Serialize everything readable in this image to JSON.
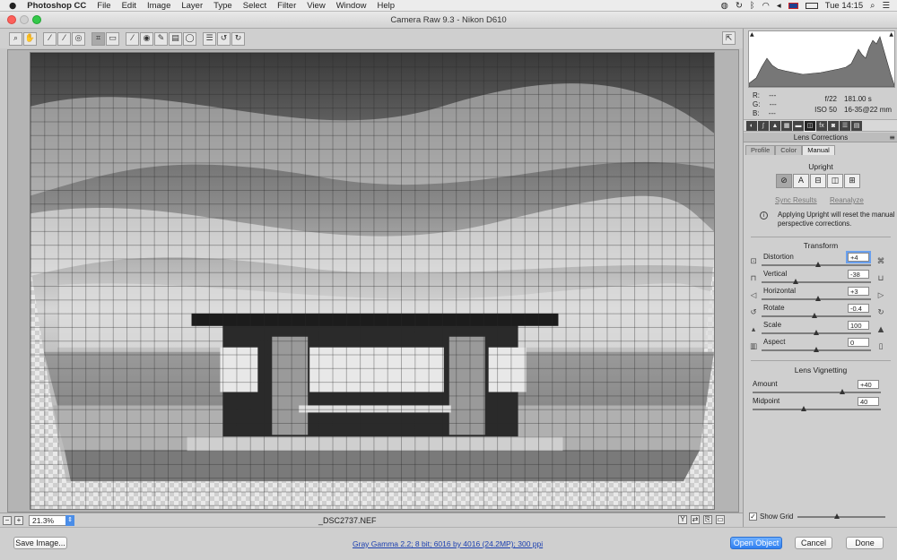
{
  "menubar": {
    "app": "Photoshop CC",
    "items": [
      "File",
      "Edit",
      "Image",
      "Layer",
      "Type",
      "Select",
      "Filter",
      "View",
      "Window",
      "Help"
    ],
    "clock": "Tue 14:15"
  },
  "window": {
    "title": "Camera Raw 9.3  -  Nikon D610"
  },
  "toolbar": {
    "tools": [
      {
        "name": "zoom-tool-icon",
        "glyph": "🔍"
      },
      {
        "name": "hand-tool-icon",
        "glyph": "✋"
      },
      {
        "name": "white-balance-icon",
        "glyph": "⁄"
      },
      {
        "name": "color-sampler-icon",
        "glyph": "⁄"
      },
      {
        "name": "targeted-adjust-icon",
        "glyph": "◎"
      },
      {
        "name": "crop-tool-icon",
        "glyph": "⌗"
      },
      {
        "name": "straighten-tool-icon",
        "glyph": "▭"
      },
      {
        "name": "spot-removal-icon",
        "glyph": "⁄"
      },
      {
        "name": "red-eye-icon",
        "glyph": "◉"
      },
      {
        "name": "adjustment-brush-icon",
        "glyph": "✎"
      },
      {
        "name": "graduated-filter-icon",
        "glyph": "▤"
      },
      {
        "name": "radial-filter-icon",
        "glyph": "◯"
      },
      {
        "name": "preferences-icon",
        "glyph": "☰"
      },
      {
        "name": "rotate-left-icon",
        "glyph": "↺"
      },
      {
        "name": "rotate-right-icon",
        "glyph": "↻"
      }
    ],
    "selected_tool": 5
  },
  "status": {
    "zoom": "21.3%",
    "filename": "_DSC2737.NEF"
  },
  "bottom": {
    "save_label": "Save Image...",
    "workflow_info": "Gray Gamma 2.2; 8 bit; 6016 by 4016 (24.2MP); 300 ppi",
    "open_label": "Open Object",
    "cancel_label": "Cancel",
    "done_label": "Done"
  },
  "readout": {
    "r": "R:",
    "r_val": "---",
    "g": "G:",
    "g_val": "---",
    "b": "B:",
    "b_val": "---",
    "aperture": "f/22",
    "shutter": "181.00 s",
    "iso": "ISO 50",
    "lens": "16-35@22 mm"
  },
  "panel": {
    "title": "Lens Corrections",
    "subtabs": [
      "Profile",
      "Color",
      "Manual"
    ],
    "selected_subtab": 2,
    "upright_title": "Upright",
    "upright_buttons": [
      {
        "name": "upright-off-icon",
        "glyph": "⊘"
      },
      {
        "name": "upright-auto-icon",
        "glyph": "A"
      },
      {
        "name": "upright-level-icon",
        "glyph": "⊟"
      },
      {
        "name": "upright-vertical-icon",
        "glyph": "◫"
      },
      {
        "name": "upright-full-icon",
        "glyph": "⊞"
      }
    ],
    "sync_results": "Sync Results",
    "reanalyze": "Reanalyze",
    "notice": "Applying Upright will reset the manual perspective corrections.",
    "transform_title": "Transform",
    "transform": [
      {
        "label": "Distortion",
        "value": "+4",
        "pos": 0.52
      },
      {
        "label": "Vertical",
        "value": "-38",
        "pos": 0.31
      },
      {
        "label": "Horizontal",
        "value": "+3",
        "pos": 0.515
      },
      {
        "label": "Rotate",
        "value": "-0.4",
        "pos": 0.48
      },
      {
        "label": "Scale",
        "value": "100",
        "pos": 0.5
      },
      {
        "label": "Aspect",
        "value": "0",
        "pos": 0.5
      }
    ],
    "vignetting_title": "Lens Vignetting",
    "vignetting": [
      {
        "label": "Amount",
        "value": "+40",
        "pos": 0.7
      },
      {
        "label": "Midpoint",
        "value": "40",
        "pos": 0.4
      }
    ],
    "show_grid": "Show Grid",
    "grid_size": 0.45
  },
  "colors": {
    "accent": "#2f7ff0",
    "panel_bg": "#cfcfcf"
  }
}
